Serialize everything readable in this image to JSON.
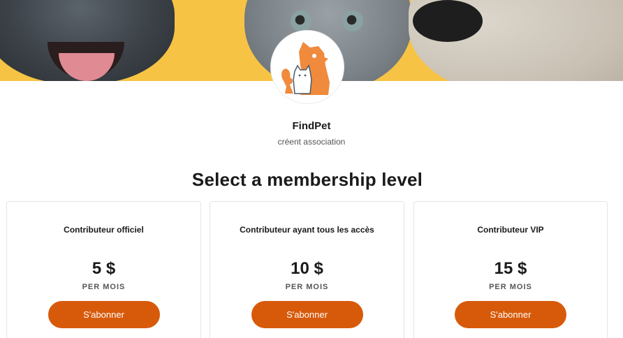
{
  "banner": {
    "alt": "pets-banner-photo"
  },
  "logo": {
    "icon": "findpet-logo-icon",
    "colors": {
      "orange": "#f08a3c",
      "slate": "#4a5a6a"
    }
  },
  "org": {
    "name": "FindPet",
    "subtitle": "créent association"
  },
  "section": {
    "title": "Select a membership level"
  },
  "tiers": [
    {
      "name": "Contributeur officiel",
      "price": "5 $",
      "period": "PER MOIS",
      "cta": "S'abonner"
    },
    {
      "name": "Contributeur ayant tous les accès",
      "price": "10 $",
      "period": "PER MOIS",
      "cta": "S'abonner"
    },
    {
      "name": "Contributeur VIP",
      "price": "15 $",
      "period": "PER MOIS",
      "cta": "S'abonner"
    }
  ],
  "colors": {
    "accent": "#d75a0a",
    "banner_bg": "#f6c344"
  }
}
